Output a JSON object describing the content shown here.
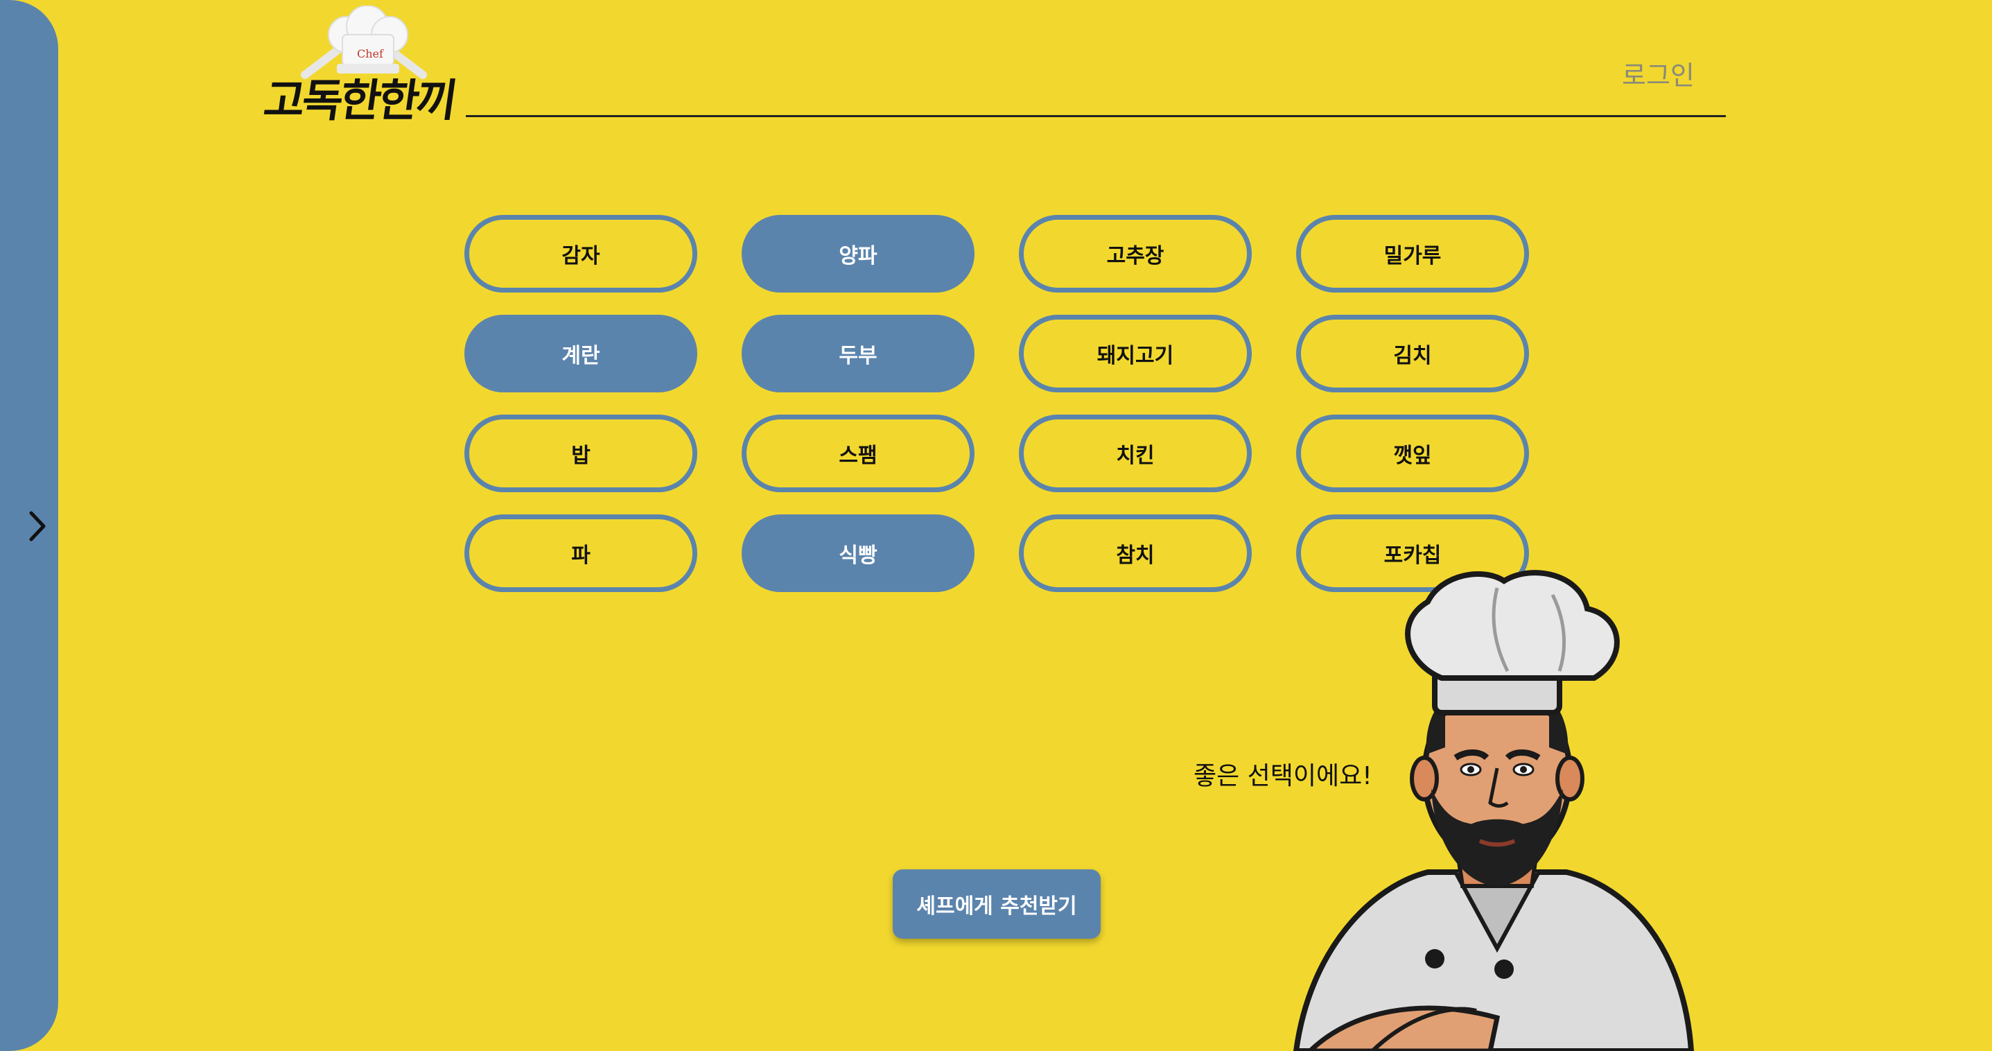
{
  "header": {
    "logo_text": "고독한한끼",
    "logo_hat_label": "Chef",
    "login_label": "로그인"
  },
  "ingredients": [
    {
      "label": "감자",
      "selected": false
    },
    {
      "label": "양파",
      "selected": true
    },
    {
      "label": "고추장",
      "selected": false
    },
    {
      "label": "밀가루",
      "selected": false
    },
    {
      "label": "계란",
      "selected": true
    },
    {
      "label": "두부",
      "selected": true
    },
    {
      "label": "돼지고기",
      "selected": false
    },
    {
      "label": "김치",
      "selected": false
    },
    {
      "label": "밥",
      "selected": false
    },
    {
      "label": "스팸",
      "selected": false
    },
    {
      "label": "치킨",
      "selected": false
    },
    {
      "label": "깻잎",
      "selected": false
    },
    {
      "label": "파",
      "selected": false
    },
    {
      "label": "식빵",
      "selected": true
    },
    {
      "label": "참치",
      "selected": false
    },
    {
      "label": "포카칩",
      "selected": false
    }
  ],
  "chef": {
    "speech": "좋은 선택이에요!"
  },
  "actions": {
    "recommend_label": "셰프에게 추천받기"
  },
  "sidebar": {
    "toggle_icon": "chevron-right-icon"
  },
  "colors": {
    "background": "#f2d82e",
    "accent": "#5b84ad",
    "text": "#111111",
    "login_text": "#8a8a7a"
  }
}
